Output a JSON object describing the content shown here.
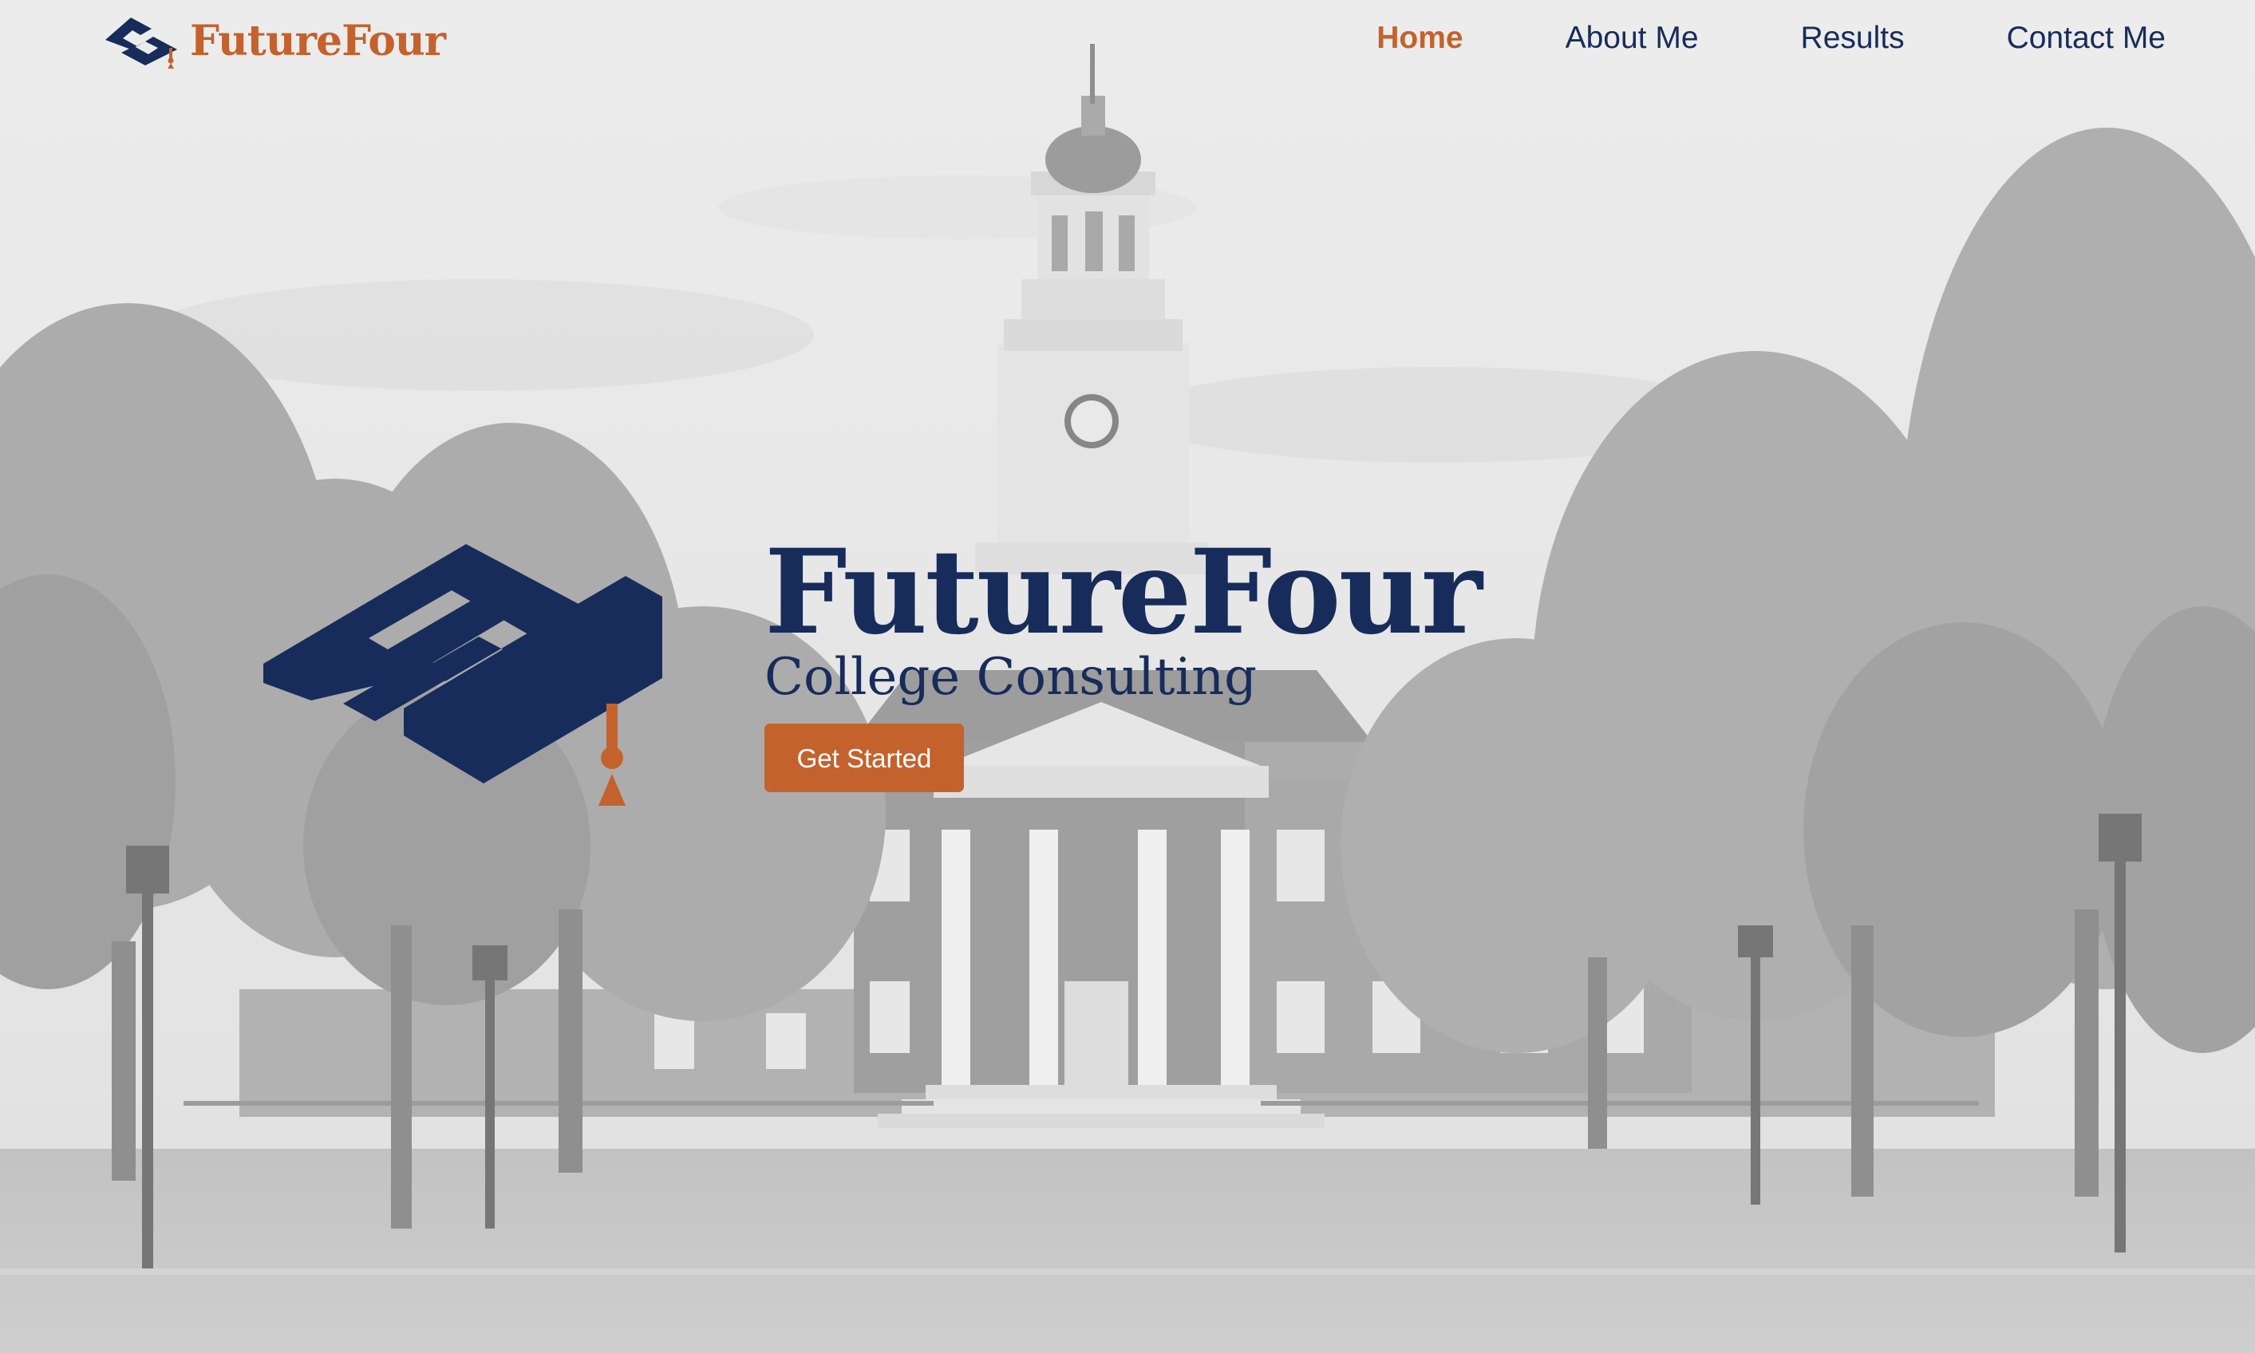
{
  "brand": {
    "name": "FutureFour",
    "logo_icon": "ff-graduation-cap-logo"
  },
  "nav": {
    "items": [
      {
        "label": "Home",
        "active": true
      },
      {
        "label": "About Me",
        "active": false
      },
      {
        "label": "Results",
        "active": false
      },
      {
        "label": "Contact Me",
        "active": false
      }
    ]
  },
  "hero": {
    "title": "FutureFour",
    "subtitle": "College Consulting",
    "cta_label": "Get Started",
    "background": "grayscale campus photo with clock tower hall"
  },
  "colors": {
    "navy": "#172c5a",
    "orange": "#c4622d",
    "button_text": "#ffffff"
  }
}
